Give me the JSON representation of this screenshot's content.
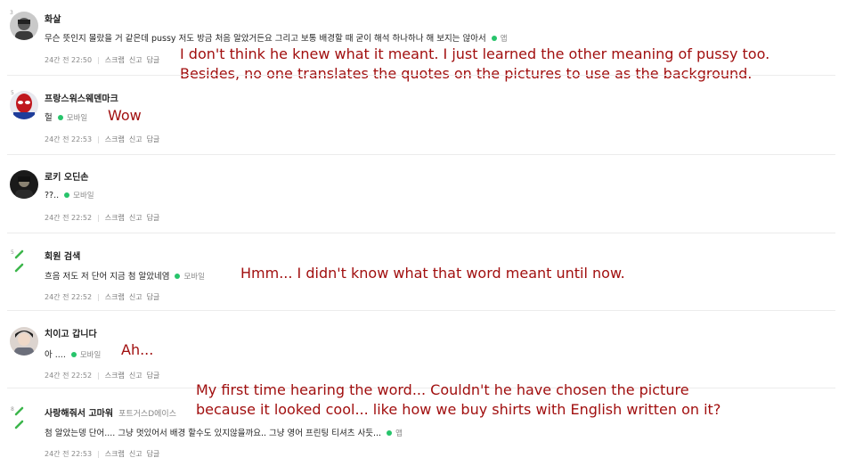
{
  "comments": [
    {
      "level": "3",
      "nickname": "화살",
      "nickname_sub": "",
      "text": "무슨 뜻인지 몰랐을 거 같은데 pussy 저도 방금 처음 알았거든요 그리고 보통 배경할 때 굳이 해석 하나하나 해 보지는 않아서",
      "source": "앱",
      "time": "24간 전 22:50",
      "actions": [
        "스크랩",
        "신고",
        "답글"
      ]
    },
    {
      "level": "5",
      "nickname": "프랑스워스웨덴마크",
      "nickname_sub": "",
      "text": "헐",
      "source": "모바일",
      "time": "24간 전 22:53",
      "actions": [
        "스크랩",
        "신고",
        "답글"
      ]
    },
    {
      "level": "",
      "nickname": "로키 오딘손",
      "nickname_sub": "",
      "text": "??..",
      "source": "모바일",
      "time": "24간 전 22:52",
      "actions": [
        "스크랩",
        "신고",
        "답글"
      ]
    },
    {
      "level": "5",
      "nickname": "회원 검색",
      "nickname_sub": "",
      "text": "흐음 저도 저 단어 지금 첨 알았네염",
      "source": "모바일",
      "time": "24간 전 22:52",
      "actions": [
        "스크랩",
        "신고",
        "답글"
      ]
    },
    {
      "level": "",
      "nickname": "치이고 갑니다",
      "nickname_sub": "",
      "text": "아 ....",
      "source": "모바일",
      "time": "24간 전 22:52",
      "actions": [
        "스크랩",
        "신고",
        "답글"
      ]
    },
    {
      "level": "8",
      "nickname": "사랑해줘서 고마워",
      "nickname_sub": "포트거스D에이스",
      "text": "첨 알았는뎅 단어.... 그냥 멋있어서 배경 할수도 있지않을까요.. 그냥 영어 프린팅 티셔츠 사듯...",
      "source": "앱",
      "time": "24간 전 22:53",
      "actions": [
        "스크랩",
        "신고",
        "답글"
      ]
    }
  ],
  "translations": {
    "t1_line1": "I don't think he knew what it meant. I just learned the other meaning of pussy too.",
    "t1_line2": "Besides, no one translates the quotes on the pictures to use as the background.",
    "t2": "Wow",
    "t4": "Hmm... I didn't know what that word meant until now.",
    "t5": "Ah...",
    "t6_line1": "My first time hearing the word... Couldn't he have chosen the picture",
    "t6_line2": "because it looked cool... like how we buy shirts with English written on it?"
  },
  "colors": {
    "translation": "#a10f0f",
    "online_dot": "#27c46b"
  }
}
